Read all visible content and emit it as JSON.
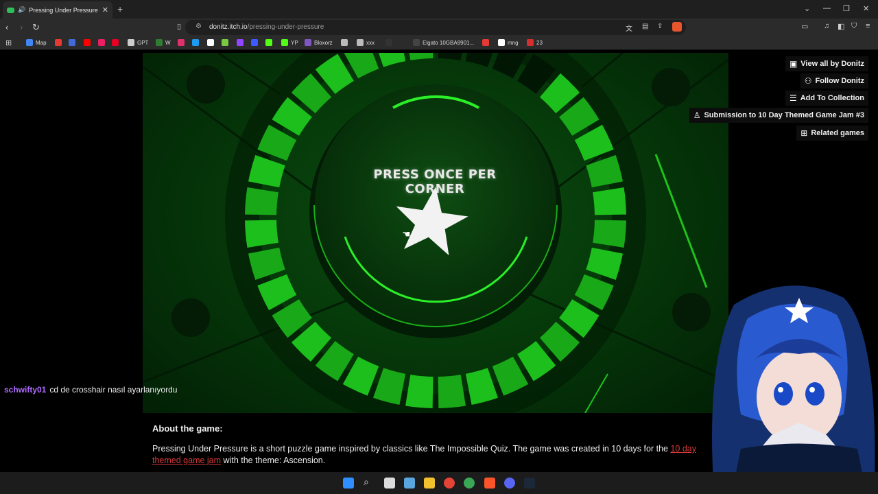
{
  "browser": {
    "tab_title": "Pressing Under Pressure by D...",
    "new_tab_icon": "+",
    "url_domain": "donitz.itch.io",
    "url_path": "/pressing-under-pressure"
  },
  "bookmarks": [
    {
      "label": "Map",
      "color": "#4285f4"
    },
    {
      "label": "",
      "color": "#e53935"
    },
    {
      "label": "",
      "color": "#3f6ad8"
    },
    {
      "label": "",
      "color": "#ff0000"
    },
    {
      "label": "",
      "color": "#e91e63"
    },
    {
      "label": "",
      "color": "#e60023"
    },
    {
      "label": "GPT",
      "color": "#cccccc"
    },
    {
      "label": "W",
      "color": "#2e7d32"
    },
    {
      "label": "",
      "color": "#e1306c"
    },
    {
      "label": "",
      "color": "#1d9bf0"
    },
    {
      "label": "",
      "color": "#ffffff"
    },
    {
      "label": "",
      "color": "#7ac943"
    },
    {
      "label": "",
      "color": "#9146ff"
    },
    {
      "label": "",
      "color": "#3d5afe"
    },
    {
      "label": "",
      "color": "#53fc18"
    },
    {
      "label": "YP",
      "color": "#53fc18"
    },
    {
      "label": "Bloxorz",
      "color": "#7e57c2"
    },
    {
      "label": "",
      "color": "#bbbbbb"
    },
    {
      "label": "xxx",
      "color": "#bbbbbb"
    },
    {
      "label": "",
      "color": "#333333"
    },
    {
      "label": "Elgato 10GBA9901...",
      "color": "#444444"
    },
    {
      "label": "",
      "color": "#e53935"
    },
    {
      "label": "mng",
      "color": "#ffffff"
    },
    {
      "label": "23",
      "color": "#d32f2f"
    }
  ],
  "game": {
    "instruction": "PRESS ONCE PER CORNER",
    "segments_total": 36,
    "segments_lit": 32
  },
  "sidebar": [
    {
      "label": "View all by Donitz",
      "icon": "collection-icon"
    },
    {
      "label": "Follow Donitz",
      "icon": "follow-icon"
    },
    {
      "label": "Add To Collection",
      "icon": "add-list-icon"
    },
    {
      "label": "Submission to 10 Day Themed Game Jam #3",
      "icon": "ribbon-icon"
    },
    {
      "label": "Related games",
      "icon": "map-icon"
    }
  ],
  "about": {
    "title": "About the game:",
    "text_before": "Pressing Under Pressure is a short puzzle game inspired by classics like The Impossible Quiz. The game was created in 10 days for the ",
    "link": "10 day themed game jam",
    "text_after": " with the theme: Ascension."
  },
  "chat": {
    "user": "schwifty01",
    "message": "cd de crosshair nasıl ayarlanıyordu"
  },
  "colors": {
    "accent_green": "#22d41e",
    "link_red": "#d83a3a",
    "chat_user": "#b06bff"
  }
}
